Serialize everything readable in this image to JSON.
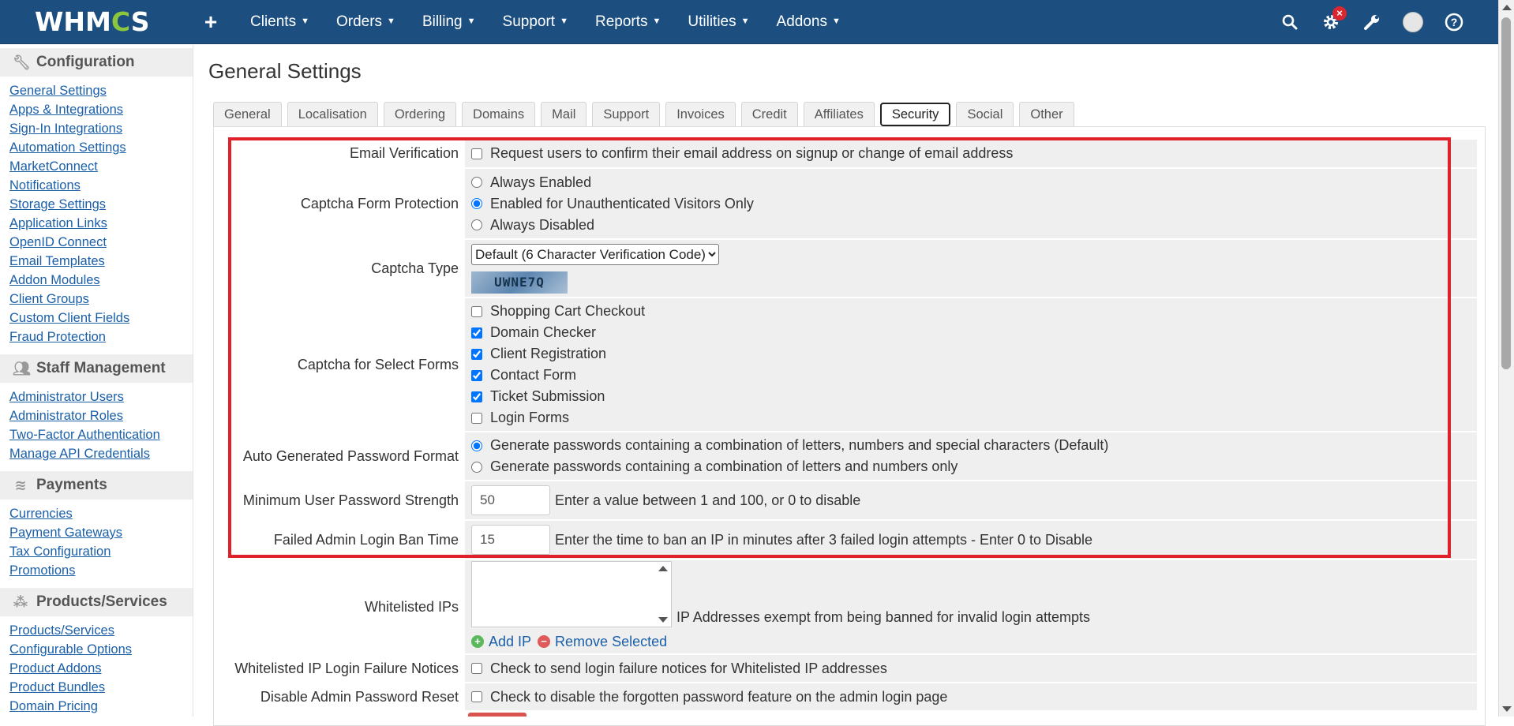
{
  "topbar": {
    "logo": "WHMCS",
    "plus": "+",
    "nav": [
      "Clients",
      "Orders",
      "Billing",
      "Support",
      "Reports",
      "Utilities",
      "Addons"
    ],
    "notification_badge": "×",
    "icons": [
      "search-icon",
      "gear-icon",
      "wrench-icon",
      "avatar",
      "help-icon"
    ],
    "bg_color": "#1c4f80"
  },
  "sidebar": {
    "sections": [
      {
        "title": "Configuration",
        "icon": "wrench-icon",
        "links": [
          "General Settings",
          "Apps & Integrations",
          "Sign-In Integrations",
          "Automation Settings",
          "MarketConnect",
          "Notifications",
          "Storage Settings",
          "Application Links",
          "OpenID Connect",
          "Email Templates",
          "Addon Modules",
          "Client Groups",
          "Custom Client Fields",
          "Fraud Protection"
        ]
      },
      {
        "title": "Staff Management",
        "icon": "users-icon",
        "links": [
          "Administrator Users",
          "Administrator Roles",
          "Two-Factor Authentication",
          "Manage API Credentials"
        ]
      },
      {
        "title": "Payments",
        "icon": "coins-icon",
        "links": [
          "Currencies",
          "Payment Gateways",
          "Tax Configuration",
          "Promotions"
        ]
      },
      {
        "title": "Products/Services",
        "icon": "cubes-icon",
        "links": [
          "Products/Services",
          "Configurable Options",
          "Product Addons",
          "Product Bundles",
          "Domain Pricing"
        ]
      }
    ]
  },
  "main": {
    "title": "General Settings",
    "tabs": [
      "General",
      "Localisation",
      "Ordering",
      "Domains",
      "Mail",
      "Support",
      "Invoices",
      "Credit",
      "Affiliates",
      "Security",
      "Social",
      "Other"
    ],
    "active_tab": "Security"
  },
  "form": {
    "email_verification": {
      "label": "Email Verification",
      "option": "Request users to confirm their email address on signup or change of email address",
      "checked": false
    },
    "captcha_form_protection": {
      "label": "Captcha Form Protection",
      "options": [
        "Always Enabled",
        "Enabled for Unauthenticated Visitors Only",
        "Always Disabled"
      ],
      "selected": "Enabled for Unauthenticated Visitors Only"
    },
    "captcha_type": {
      "label": "Captcha Type",
      "value": "Default (6 Character Verification Code)",
      "preview_text": "UWNE7Q"
    },
    "captcha_select_forms": {
      "label": "Captcha for Select Forms",
      "options": [
        "Shopping Cart Checkout",
        "Domain Checker",
        "Client Registration",
        "Contact Form",
        "Ticket Submission",
        "Login Forms"
      ],
      "checked": [
        false,
        true,
        true,
        true,
        true,
        false
      ]
    },
    "password_format": {
      "label": "Auto Generated Password Format",
      "options": [
        "Generate passwords containing a combination of letters, numbers and special characters (Default)",
        "Generate passwords containing a combination of letters and numbers only"
      ],
      "selected": "Generate passwords containing a combination of letters, numbers and special characters (Default)"
    },
    "min_password_strength": {
      "label": "Minimum User Password Strength",
      "value": "50",
      "hint": "Enter a value between 1 and 100, or 0 to disable"
    },
    "failed_login_ban": {
      "label": "Failed Admin Login Ban Time",
      "value": "15",
      "hint": "Enter the time to ban an IP in minutes after 3 failed login attempts - Enter 0 to Disable"
    },
    "whitelisted_ips": {
      "label": "Whitelisted IPs",
      "hint": "IP Addresses exempt from being banned for invalid login attempts",
      "add_label": "Add IP",
      "remove_label": "Remove Selected"
    },
    "whitelist_notices": {
      "label": "Whitelisted IP Login Failure Notices",
      "option": "Check to send login failure notices for Whitelisted IP addresses",
      "checked": false
    },
    "disable_pw_reset": {
      "label": "Disable Admin Password Reset",
      "option": "Check to disable the forgotten password feature on the admin login page",
      "checked": false
    }
  },
  "colors": {
    "highlight": "#e0202b",
    "link": "#1a5fa8"
  }
}
